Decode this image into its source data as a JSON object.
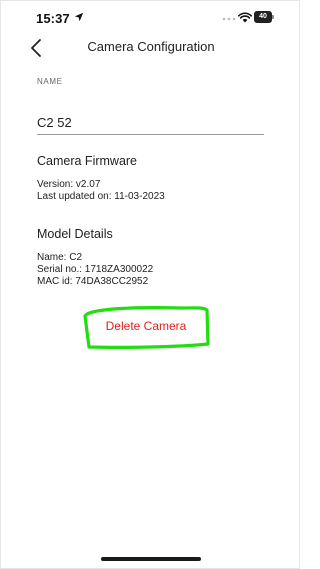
{
  "status_bar": {
    "time": "15:37",
    "battery_text": "40",
    "battery_level": 0.4
  },
  "nav": {
    "title": "Camera Configuration"
  },
  "name_field": {
    "label": "NAME",
    "value": "C2 52"
  },
  "firmware": {
    "title": "Camera Firmware",
    "version": "Version: v2.07",
    "last_updated": "Last updated on: 11-03-2023"
  },
  "model": {
    "title": "Model Details",
    "name": "Name: C2",
    "serial": "Serial no.: 1718ZA300022",
    "mac": "MAC id: 74DA38CC2952"
  },
  "actions": {
    "delete_label": "Delete Camera"
  },
  "colors": {
    "delete_text": "#e02020",
    "highlight": "#22dd11"
  },
  "icons": {
    "back": "chevron-left-icon",
    "location": "location-arrow-icon",
    "wifi": "wifi-icon",
    "battery": "battery-icon"
  }
}
